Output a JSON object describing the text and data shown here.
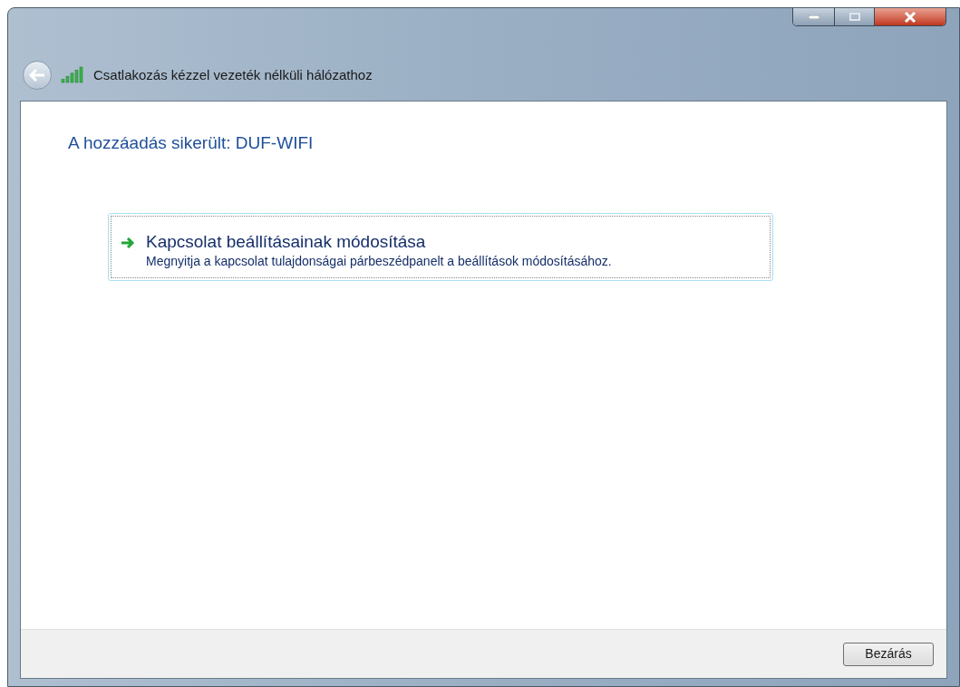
{
  "window": {
    "title": "Csatlakozás kézzel vezeték nélküli hálózathoz"
  },
  "heading": "A hozzáadás sikerült: DUF-WIFI",
  "command_link": {
    "title": "Kapcsolat beállításainak módosítása",
    "description": "Megnyitja a kapcsolat tulajdonságai párbeszédpanelt a beállítások módosításához.",
    "focused": true
  },
  "buttons": [
    "Bezárás"
  ]
}
